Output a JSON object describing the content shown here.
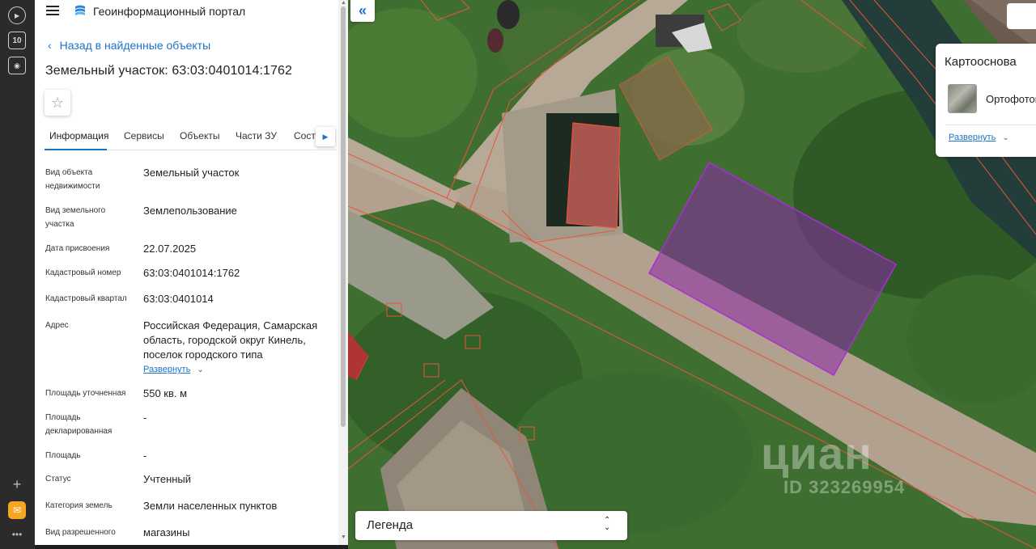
{
  "browser_sidebar": {
    "items": [
      "play-icon",
      "number-ten-icon",
      "screenshot-icon",
      "plus-icon",
      "mail-icon",
      "more-icon"
    ],
    "badge_label": "10"
  },
  "header": {
    "title": "Геоинформационный портал"
  },
  "back_link": "Назад в найденные объекты",
  "object_title": "Земельный участок: 63:03:0401014:1762",
  "tabs": [
    {
      "label": "Информация",
      "active": true
    },
    {
      "label": "Сервисы"
    },
    {
      "label": "Объекты"
    },
    {
      "label": "Части ЗУ"
    },
    {
      "label": "Соста"
    }
  ],
  "properties": [
    {
      "label": "Вид объекта недвижимости",
      "value": "Земельный участок"
    },
    {
      "label": "Вид земельного участка",
      "value": "Землепользование"
    },
    {
      "label": "Дата присвоения",
      "value": "22.07.2025"
    },
    {
      "label": "Кадастровый номер",
      "value": "63:03:0401014:1762"
    },
    {
      "label": "Кадастровый квартал",
      "value": "63:03:0401014"
    },
    {
      "label": "Адрес",
      "value": "Российская Федерация, Самарская область, городской округ Кинель, поселок городского типа",
      "expand": "Развернуть"
    },
    {
      "label": "Площадь уточненная",
      "value": "550 кв. м"
    },
    {
      "label": "Площадь декларированная",
      "value": "-"
    },
    {
      "label": "Площадь",
      "value": "-"
    },
    {
      "label": "Статус",
      "value": "Учтенный"
    },
    {
      "label": "Категория земель",
      "value": "Земли населенных пунктов"
    },
    {
      "label": "Вид разрешенного",
      "value": "магазины"
    }
  ],
  "basemap_panel": {
    "title": "Картооснова",
    "layer_name": "Ортофотоплан",
    "expand": "Развернуть"
  },
  "legend": {
    "label": "Легенда"
  },
  "watermark": {
    "logo": "циан",
    "id": "ID 323269954"
  },
  "colors": {
    "accent": "#1a73c9",
    "parcel_outline": "#e8553a",
    "selected_parcel": "#a020c8"
  }
}
